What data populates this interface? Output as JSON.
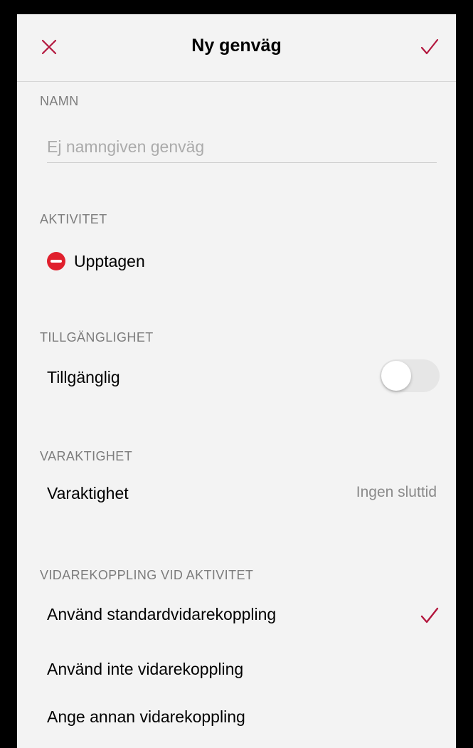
{
  "header": {
    "title": "Ny genväg",
    "accent_color": "#b3163d"
  },
  "name_section": {
    "header": "NAMN",
    "placeholder": "Ej namngiven genväg",
    "value": ""
  },
  "activity_section": {
    "header": "AKTIVITET",
    "status_label": "Upptagen",
    "status_icon": "busy-icon",
    "status_color": "#e0202d"
  },
  "availability_section": {
    "header": "TILLGÄNGLIGHET",
    "toggle_label": "Tillgänglig",
    "toggle_on": false
  },
  "duration_section": {
    "header": "VARAKTIGHET",
    "label": "Varaktighet",
    "value": "Ingen sluttid"
  },
  "forwarding_section": {
    "header": "VIDAREKOPPLING VID AKTIVITET",
    "options": [
      {
        "label": "Använd standardvidarekoppling",
        "selected": true
      },
      {
        "label": "Använd inte vidarekoppling",
        "selected": false
      },
      {
        "label": "Ange annan vidarekoppling",
        "selected": false
      }
    ]
  }
}
